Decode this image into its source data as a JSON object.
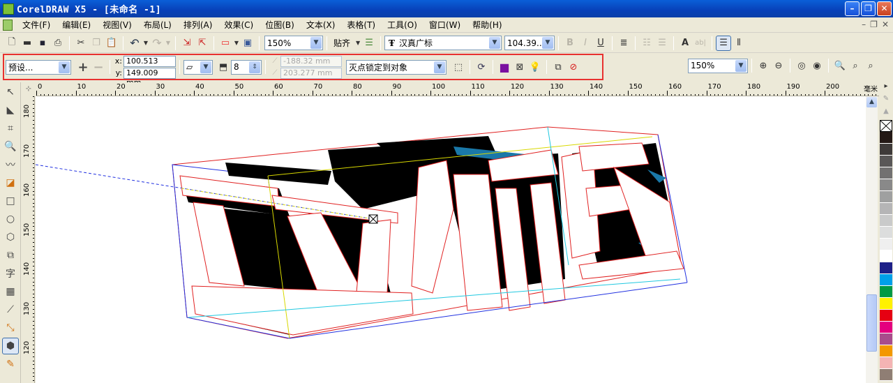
{
  "window": {
    "title": "CorelDRAW X5 - [未命名 -1]",
    "controls": [
      "minimize",
      "restore",
      "close"
    ]
  },
  "menu": {
    "items": [
      "文件(F)",
      "编辑(E)",
      "视图(V)",
      "布局(L)",
      "排列(A)",
      "效果(C)",
      "位图(B)",
      "文本(X)",
      "表格(T)",
      "工具(O)",
      "窗口(W)",
      "帮助(H)"
    ]
  },
  "standard_toolbar": {
    "zoom_level": "150%",
    "snap_label": "贴齐",
    "font_name": "汉真广标",
    "font_size": "104.39..."
  },
  "property_bar": {
    "preset": "预设...",
    "x_label": "x:",
    "x_value": "100.513 mm",
    "y_label": "y:",
    "y_value": "149.009 mm",
    "depth_value": "8",
    "vp_x_value": "-188.32 mm",
    "vp_y_value": "203.277 mm",
    "vanishing_point_mode": "灭点锁定到对象"
  },
  "zoom_toolbar": {
    "zoom_level": "150%"
  },
  "ruler": {
    "h_labels": [
      "0",
      "10",
      "20",
      "30",
      "40",
      "50",
      "60",
      "70",
      "80",
      "90",
      "100",
      "110",
      "120",
      "130",
      "140",
      "150",
      "160",
      "170",
      "180",
      "190",
      "200"
    ],
    "v_labels": [
      "180",
      "170",
      "160",
      "150",
      "140",
      "130",
      "120"
    ],
    "units": "毫米"
  },
  "canvas": {
    "artwork_text": "立体感"
  },
  "palette": {
    "colors": [
      "#231815",
      "#3e3a39",
      "#595757",
      "#727171",
      "#898989",
      "#9fa0a0",
      "#b5b5b6",
      "#c9caca",
      "#dcdddd",
      "#efefef",
      "#ffffff",
      "#1d2088",
      "#00a0e9",
      "#009944",
      "#fff100",
      "#e60012",
      "#e4007f",
      "#a84c8c",
      "#f39800",
      "#f4b4b4",
      "#8f7e74"
    ]
  }
}
